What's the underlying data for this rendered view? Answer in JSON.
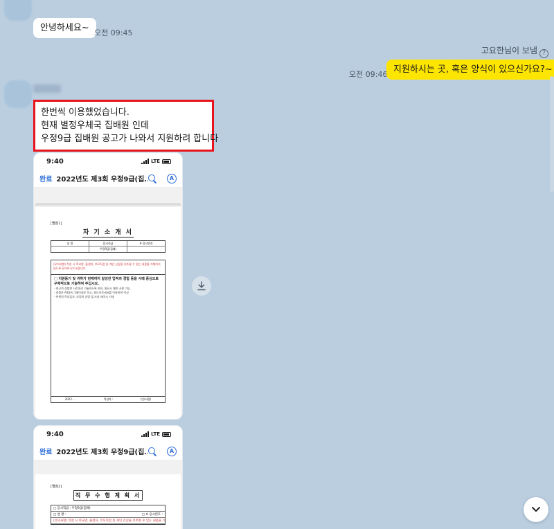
{
  "messages": {
    "first": {
      "text": "안녕하세요~",
      "time": "오전 09:45"
    },
    "reply_note": {
      "text": "고요한님이 보냄",
      "help_glyph": "?"
    },
    "mine": {
      "text": "지원하시는 곳, 혹은 양식이 있으신가요?~",
      "time": "오전 09:46"
    },
    "highlighted": {
      "lines": [
        "한번씩 이용했었습니다.",
        "현재 별정우체국 집배원 인데",
        "우정9급 집배원 공고가 나와서 지원하려 합니다"
      ]
    }
  },
  "phone1": {
    "time": "9:40",
    "network": "LTE",
    "nav_done": "완료",
    "nav_title": "2022년도 제3회 우정9급(집…",
    "nav_a": "A",
    "doc": {
      "tag": "[별첨1]",
      "title": "자 기 소 개 서",
      "header_row": [
        "성 명",
        "응시직급",
        "※ 응시번호"
      ],
      "value_row": [
        "",
        "우정9급(집배)",
        ""
      ],
      "note": "(유의사항) 작성 시 학교명, 출생지, 부모직업 등 개인 신상을 유추할 수 있는 내용을 기재하지 않도록 유의하시기 바랍니다",
      "q_title": "□ 지원동기 및 귀하가 현재까지 달성한 업적과 경험 등을 사례 중심으로 구체적으로 기술하여 주십시오.",
      "items": [
        "- 최근의 경험한 사건처리 기술하도록 하되, 필요시 별지 사용 가능",
        "- 경쟁은 A4용지 1매이내로 하고, 워드프로세서를 이용하여 작성",
        "- 허위의 작성입자, 부정의 성명 및 사실 왜곡시 기재"
      ],
      "sign_left": "2022. . .",
      "sign_mid": "작성자 :",
      "sign_right": "(인/서명)"
    }
  },
  "phone2": {
    "time": "9:40",
    "network": "LTE",
    "nav_done": "완료",
    "nav_title": "2022년도 제3회 우정9급(집…",
    "nav_a": "A",
    "doc": {
      "tag": "[별첨2]",
      "title": "직 무 수 행 계 획 서",
      "row1_left": "□ 응시직급 : 우정9급(집배)",
      "row2_left": "□ 성    명 :",
      "row2_right": "□ ※ 응시번호 :",
      "note": "(유의사항) 작성 시 학교명, 출생지, 부모직업 등 개인 신상을 유추할 수 있는 내용을 기재하지 않도록"
    }
  },
  "icons": {
    "download": "download-icon",
    "scroll_down": "chevron-down-icon"
  }
}
